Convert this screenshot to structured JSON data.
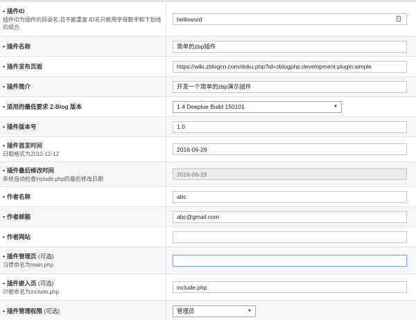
{
  "rows": [
    {
      "label": "插件ID",
      "optional": "",
      "desc": "插件ID为插件的目录名,且不能重复.ID名只能用字母数字和下划线的组合.",
      "field": {
        "type": "text",
        "value": "helloword",
        "icon": "id-card-icon"
      }
    },
    {
      "label": "插件名称",
      "optional": "",
      "desc": "",
      "field": {
        "type": "text",
        "value": "简单的zbp插件"
      }
    },
    {
      "label": "插件发布页面",
      "optional": "",
      "desc": "",
      "field": {
        "type": "text",
        "value": "https://wiki.zblogcn.com/doku.php?id=zblogphp:development:plugin:simple"
      }
    },
    {
      "label": "插件简介",
      "optional": "",
      "desc": "",
      "field": {
        "type": "text",
        "value": "开发一个简单的zbp演示插件"
      }
    },
    {
      "label": "适用的最低要求 Z-Blog 版本",
      "optional": "",
      "desc": "",
      "field": {
        "type": "select",
        "value": "1.4 Deeplue Build 150101",
        "width": "wide"
      }
    },
    {
      "label": "插件版本号",
      "optional": "",
      "desc": "",
      "field": {
        "type": "text",
        "value": "1.0"
      }
    },
    {
      "label": "插件首发时间",
      "optional": "",
      "desc": "日期格式为2012-12-12",
      "field": {
        "type": "text",
        "value": "2016-06-29"
      }
    },
    {
      "label": "插件最后修改时间",
      "optional": "",
      "desc": "系统自动检查include.php的最后修改日期",
      "field": {
        "type": "text",
        "value": "2016-06-29",
        "disabled": true
      }
    },
    {
      "label": "作者名称",
      "optional": "",
      "desc": "",
      "field": {
        "type": "text",
        "value": "abc"
      }
    },
    {
      "label": "作者邮箱",
      "optional": "",
      "desc": "",
      "field": {
        "type": "text",
        "value": "abc@gmail.com"
      }
    },
    {
      "label": "作者网站",
      "optional": "",
      "desc": "",
      "field": {
        "type": "text",
        "value": ""
      }
    },
    {
      "label": "插件管理页",
      "optional": "(可选)",
      "desc": "习惯命名为main.php",
      "field": {
        "type": "text",
        "value": "",
        "focused": true
      }
    },
    {
      "label": "插件嵌入页",
      "optional": "(可选)",
      "desc": "只能命名为include.php",
      "field": {
        "type": "text",
        "value": "include.php"
      }
    },
    {
      "label": "插件管理权限",
      "optional": "(可选)",
      "desc": "",
      "field": {
        "type": "select",
        "value": "管理员",
        "width": "narrow"
      }
    },
    {
      "label": "",
      "optional": "",
      "desc": "",
      "field": {
        "type": "none"
      }
    }
  ]
}
